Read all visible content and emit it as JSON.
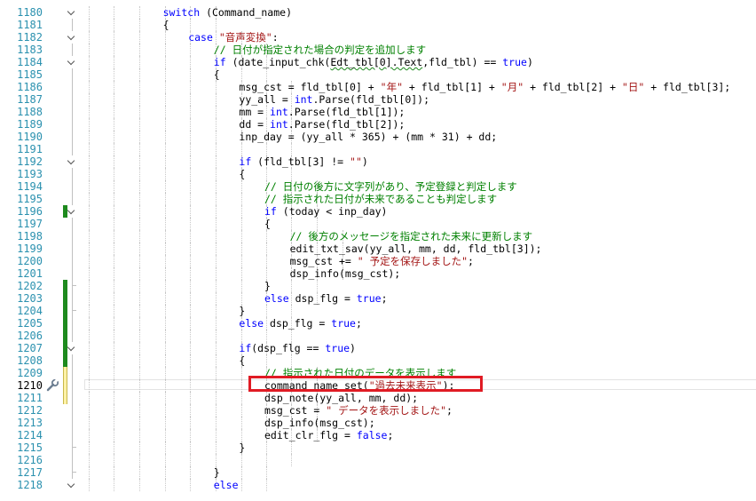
{
  "editor": {
    "colors": {
      "keyword": "#0000ff",
      "string": "#a31515",
      "comment": "#008000",
      "line_number": "#2b91af",
      "change_saved": "#1e8a1e",
      "change_unsaved": "#fff2a8",
      "highlight_box": "#e01b24"
    },
    "quick_action_icon": "wrench-icon",
    "current_line": 1210,
    "highlighted_line": 1210,
    "lines": [
      {
        "n": "1180",
        "indent": 6,
        "fold": "open",
        "tokens": [
          [
            "kw",
            "switch"
          ],
          [
            "t",
            " (Command_name)"
          ]
        ]
      },
      {
        "n": "1181",
        "indent": 6,
        "fold": "line",
        "tokens": [
          [
            "t",
            "{"
          ]
        ]
      },
      {
        "n": "1182",
        "indent": 7,
        "fold": "open",
        "tokens": [
          [
            "kw",
            "case"
          ],
          [
            "t",
            " "
          ],
          [
            "str",
            "\"音声変換\""
          ],
          [
            "t",
            ":"
          ]
        ]
      },
      {
        "n": "1183",
        "indent": 8,
        "fold": "line",
        "tokens": [
          [
            "cm",
            "// 日付が指定された場合の判定を追加します"
          ]
        ]
      },
      {
        "n": "1184",
        "indent": 8,
        "fold": "open",
        "tokens": [
          [
            "kw",
            "if"
          ],
          [
            "t",
            " (date_input_chk("
          ],
          [
            "sq",
            "Edt_tbl[0].Text"
          ],
          [
            "t",
            ",fld_tbl) == "
          ],
          [
            "kw",
            "true"
          ],
          [
            "t",
            ")"
          ]
        ]
      },
      {
        "n": "1185",
        "indent": 8,
        "fold": "line",
        "tokens": [
          [
            "t",
            "{"
          ]
        ]
      },
      {
        "n": "1186",
        "indent": 9,
        "fold": "line",
        "tokens": [
          [
            "t",
            "msg_cst = fld_tbl[0] + "
          ],
          [
            "str",
            "\"年\""
          ],
          [
            "t",
            " + fld_tbl[1] + "
          ],
          [
            "str",
            "\"月\""
          ],
          [
            "t",
            " + fld_tbl[2] + "
          ],
          [
            "str",
            "\"日\""
          ],
          [
            "t",
            " + fld_tbl[3];"
          ]
        ]
      },
      {
        "n": "1187",
        "indent": 9,
        "fold": "line",
        "tokens": [
          [
            "t",
            "yy_all = "
          ],
          [
            "kw",
            "int"
          ],
          [
            "t",
            ".Parse(fld_tbl[0]);"
          ]
        ]
      },
      {
        "n": "1188",
        "indent": 9,
        "fold": "line",
        "tokens": [
          [
            "t",
            "mm = "
          ],
          [
            "kw",
            "int"
          ],
          [
            "t",
            ".Parse(fld_tbl[1]);"
          ]
        ]
      },
      {
        "n": "1189",
        "indent": 9,
        "fold": "line",
        "tokens": [
          [
            "t",
            "dd = "
          ],
          [
            "kw",
            "int"
          ],
          [
            "t",
            ".Parse(fld_tbl[2]);"
          ]
        ]
      },
      {
        "n": "1190",
        "indent": 9,
        "fold": "line",
        "tokens": [
          [
            "t",
            "inp_day = (yy_all * 365) + (mm * 31) + dd;"
          ]
        ]
      },
      {
        "n": "1191",
        "indent": 9,
        "fold": "line",
        "tokens": []
      },
      {
        "n": "1192",
        "indent": 9,
        "fold": "open",
        "tokens": [
          [
            "kw",
            "if"
          ],
          [
            "t",
            " (fld_tbl[3] != "
          ],
          [
            "str",
            "\"\""
          ],
          [
            "t",
            ")"
          ]
        ]
      },
      {
        "n": "1193",
        "indent": 9,
        "fold": "line",
        "tokens": [
          [
            "t",
            "{"
          ]
        ]
      },
      {
        "n": "1194",
        "indent": 10,
        "fold": "line",
        "tokens": [
          [
            "cm",
            "// 日付の後方に文字列があり、予定登録と判定します"
          ]
        ]
      },
      {
        "n": "1195",
        "indent": 10,
        "fold": "line",
        "tokens": [
          [
            "cm",
            "// 指示された日付が未来であることも判定します"
          ]
        ]
      },
      {
        "n": "1196",
        "indent": 10,
        "fold": "open",
        "change": "saved",
        "tokens": [
          [
            "kw",
            "if"
          ],
          [
            "t",
            " (today < inp_day)"
          ]
        ]
      },
      {
        "n": "1197",
        "indent": 10,
        "fold": "line",
        "tokens": [
          [
            "t",
            "{"
          ]
        ]
      },
      {
        "n": "1198",
        "indent": 11,
        "fold": "line",
        "tokens": [
          [
            "cm",
            "// 後方のメッセージを指定された未来に更新します"
          ]
        ]
      },
      {
        "n": "1199",
        "indent": 11,
        "fold": "line",
        "tokens": [
          [
            "t",
            "edit_txt_sav(yy_all, mm, dd, fld_tbl[3]);"
          ]
        ]
      },
      {
        "n": "1200",
        "indent": 11,
        "fold": "line",
        "tokens": [
          [
            "t",
            "msg_cst += "
          ],
          [
            "str",
            "\" 予定を保存しました\""
          ],
          [
            "t",
            ";"
          ]
        ]
      },
      {
        "n": "1201",
        "indent": 11,
        "fold": "line",
        "tokens": [
          [
            "t",
            "dsp_info(msg_cst);"
          ]
        ]
      },
      {
        "n": "1202",
        "indent": 10,
        "fold": "end",
        "change": "saved",
        "tokens": [
          [
            "t",
            "}"
          ]
        ]
      },
      {
        "n": "1203",
        "indent": 10,
        "fold": "line",
        "change": "saved",
        "tokens": [
          [
            "kw",
            "else"
          ],
          [
            "t",
            " dsp_flg = "
          ],
          [
            "kw",
            "true"
          ],
          [
            "t",
            ";"
          ]
        ]
      },
      {
        "n": "1204",
        "indent": 9,
        "fold": "end",
        "change": "saved",
        "tokens": [
          [
            "t",
            "}"
          ]
        ]
      },
      {
        "n": "1205",
        "indent": 9,
        "fold": "line",
        "change": "saved",
        "tokens": [
          [
            "kw",
            "else"
          ],
          [
            "t",
            " dsp_flg = "
          ],
          [
            "kw",
            "true"
          ],
          [
            "t",
            ";"
          ]
        ]
      },
      {
        "n": "1206",
        "indent": 9,
        "fold": "line",
        "change": "saved",
        "tokens": []
      },
      {
        "n": "1207",
        "indent": 9,
        "fold": "open",
        "change": "saved",
        "tokens": [
          [
            "kw",
            "if"
          ],
          [
            "t",
            "(dsp_flg == "
          ],
          [
            "kw",
            "true"
          ],
          [
            "t",
            ")"
          ]
        ]
      },
      {
        "n": "1208",
        "indent": 9,
        "fold": "line",
        "change": "saved",
        "tokens": [
          [
            "t",
            "{"
          ]
        ]
      },
      {
        "n": "1209",
        "indent": 10,
        "fold": "line",
        "change": "unsaved",
        "tokens": [
          [
            "cm",
            "// 指示された日付のデータを表示します"
          ]
        ]
      },
      {
        "n": "1210",
        "indent": 10,
        "fold": "line",
        "change": "unsaved",
        "tokens": [
          [
            "t",
            "command_name_set("
          ],
          [
            "str",
            "\"過去未来表示\""
          ],
          [
            "t",
            ");"
          ]
        ]
      },
      {
        "n": "1211",
        "indent": 10,
        "fold": "line",
        "change": "unsaved",
        "tokens": [
          [
            "t",
            "dsp_note(yy_all, mm, dd);"
          ]
        ]
      },
      {
        "n": "1212",
        "indent": 10,
        "fold": "line",
        "tokens": [
          [
            "t",
            "msg_cst = "
          ],
          [
            "str",
            "\" データを表示しました\""
          ],
          [
            "t",
            ";"
          ]
        ]
      },
      {
        "n": "1213",
        "indent": 10,
        "fold": "line",
        "tokens": [
          [
            "t",
            "dsp_info(msg_cst);"
          ]
        ]
      },
      {
        "n": "1214",
        "indent": 10,
        "fold": "line",
        "tokens": [
          [
            "t",
            "edit_clr_flg = "
          ],
          [
            "kw",
            "false"
          ],
          [
            "t",
            ";"
          ]
        ]
      },
      {
        "n": "1215",
        "indent": 9,
        "fold": "end",
        "tokens": [
          [
            "t",
            "}"
          ]
        ]
      },
      {
        "n": "1216",
        "indent": 9,
        "fold": "line",
        "tokens": []
      },
      {
        "n": "1217",
        "indent": 8,
        "fold": "end",
        "tokens": [
          [
            "t",
            "}"
          ]
        ]
      },
      {
        "n": "1218",
        "indent": 8,
        "fold": "open",
        "tokens": [
          [
            "kw",
            "else"
          ]
        ]
      }
    ]
  }
}
